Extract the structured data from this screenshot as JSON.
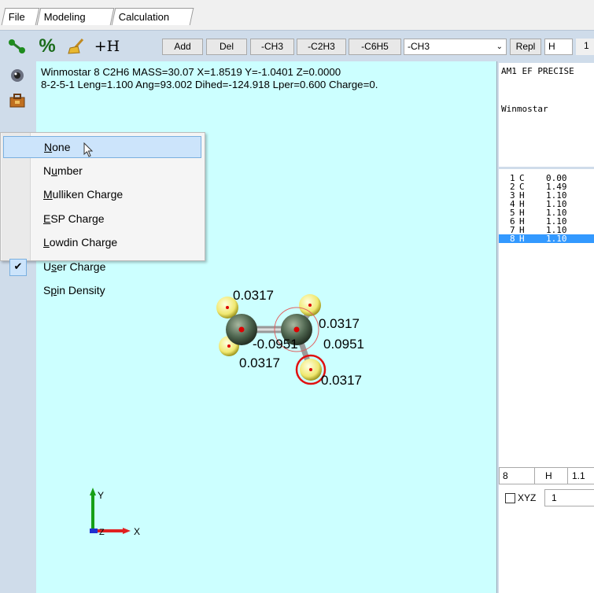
{
  "tabs": [
    {
      "label": "File"
    },
    {
      "label": "Modeling"
    },
    {
      "label": "Calculation"
    }
  ],
  "toolbar": {
    "buttons": [
      "Add",
      "Del",
      "-CH3",
      "-C2H3",
      "-C6H5"
    ],
    "fragment_select": "-CH3",
    "repl_label": "Repl",
    "atom_field": "H",
    "extra_field": "1"
  },
  "canvas": {
    "info_line1": "Winmostar  8  C2H6  MASS=30.07  X=1.8519  Y=-1.0401  Z=0.0000",
    "info_line2": "8-2-5-1 Leng=1.100 Ang=93.002 Dihed=-124.918 Lper=0.600 Charge=0.",
    "labels": {
      "h_top_left": "0.0317",
      "h_top_right": "0.0317",
      "c_left": "-0.0951",
      "c_right": "0.0951",
      "h_bottom_left": "0.0317",
      "h_bottom_right": "0.0317"
    },
    "axis_y": "Y",
    "axis_x": "X",
    "axis_z": "Z"
  },
  "context_menu": {
    "items": [
      {
        "label": "None",
        "mnemonic_index": 0,
        "checked": false,
        "highlighted": true
      },
      {
        "label": "Number",
        "mnemonic_index": 1,
        "checked": false,
        "highlighted": false
      },
      {
        "label": "Mulliken Charge",
        "mnemonic_index": 0,
        "checked": false,
        "highlighted": false
      },
      {
        "label": "ESP Charge",
        "mnemonic_index": 0,
        "checked": false,
        "highlighted": false
      },
      {
        "label": "Lowdin Charge",
        "mnemonic_index": 0,
        "checked": false,
        "highlighted": false
      },
      {
        "label": "User Charge",
        "mnemonic_index": 1,
        "checked": true,
        "highlighted": false
      },
      {
        "label": "Spin Density",
        "mnemonic_index": 1,
        "checked": false,
        "highlighted": false
      }
    ]
  },
  "right_panel": {
    "keyword_text": "AM1 EF PRECISE",
    "title_text": "Winmostar",
    "atoms": [
      {
        "num": "1",
        "el": "C",
        "val": "0.00"
      },
      {
        "num": "2",
        "el": "C",
        "val": "1.49"
      },
      {
        "num": "3",
        "el": "H",
        "val": "1.10"
      },
      {
        "num": "4",
        "el": "H",
        "val": "1.10"
      },
      {
        "num": "5",
        "el": "H",
        "val": "1.10"
      },
      {
        "num": "6",
        "el": "H",
        "val": "1.10"
      },
      {
        "num": "7",
        "el": "H",
        "val": "1.10"
      },
      {
        "num": "8",
        "el": "H",
        "val": "1.10"
      }
    ],
    "edit_num": "8",
    "edit_el": "H",
    "edit_val": "1.1",
    "xyz_label": "XYZ",
    "xyz_field": "1"
  },
  "colors": {
    "canvas_bg": "#ccffff",
    "toolbar_bg": "#cfdcea",
    "selection": "#3399ff"
  }
}
